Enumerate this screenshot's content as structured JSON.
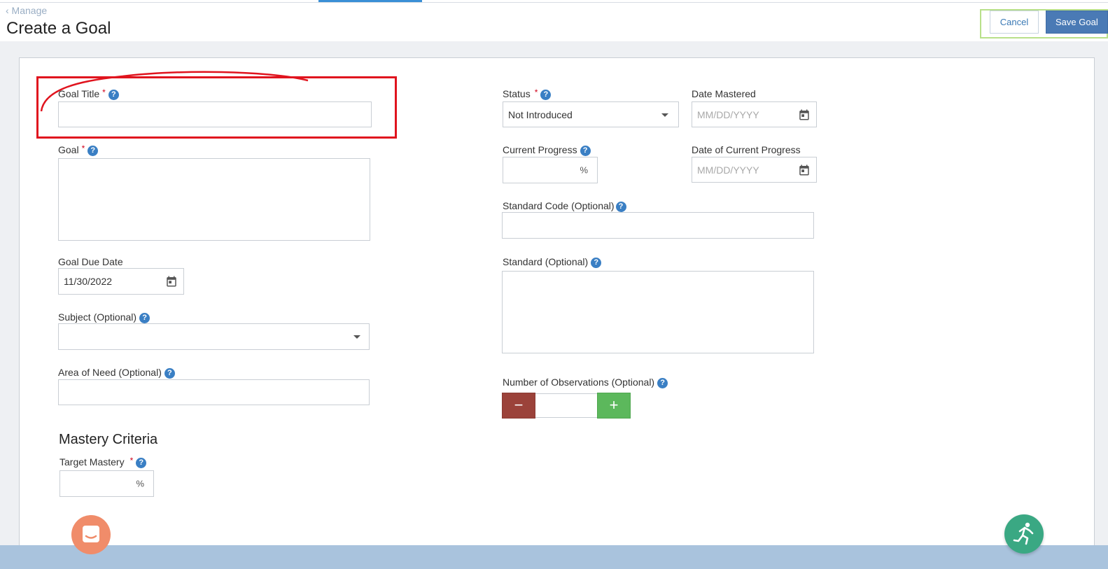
{
  "header": {
    "back_link": "‹ Manage",
    "title": "Create a Goal",
    "cancel_label": "Cancel",
    "save_label": "Save Goal"
  },
  "form": {
    "goal_title": {
      "label": "Goal Title",
      "required": "*",
      "value": ""
    },
    "goal": {
      "label": "Goal",
      "required": "*",
      "value": ""
    },
    "goal_due_date": {
      "label": "Goal Due Date",
      "value": "11/30/2022"
    },
    "subject": {
      "label": "Subject (Optional)",
      "selected": ""
    },
    "area_of_need": {
      "label": "Area of Need (Optional)",
      "value": ""
    },
    "status": {
      "label": "Status",
      "required": "*",
      "selected": "Not Introduced"
    },
    "date_mastered": {
      "label": "Date Mastered",
      "placeholder": "MM/DD/YYYY"
    },
    "current_progress": {
      "label": "Current Progress",
      "unit": "%"
    },
    "date_current_progress": {
      "label": "Date of Current Progress",
      "placeholder": "MM/DD/YYYY"
    },
    "standard_code": {
      "label": "Standard Code (Optional)",
      "value": ""
    },
    "standard": {
      "label": "Standard (Optional)",
      "value": ""
    },
    "observations": {
      "label": "Number of Observations (Optional)",
      "minus": "−",
      "plus": "+",
      "value": ""
    }
  },
  "mastery": {
    "section_title": "Mastery Criteria",
    "target_label": "Target Mastery",
    "required": "*",
    "unit": "%"
  },
  "help_glyph": "?",
  "colors": {
    "accent_blue": "#4a7ab5",
    "help_blue": "#3a7fc4",
    "annotation_red": "#e0141e",
    "minus_red": "#9b423a",
    "plus_green": "#5cb85c",
    "chat_orange": "#f08c6a",
    "run_green": "#3aa883"
  },
  "icons": [
    "calendar-icon",
    "chevron-down-icon",
    "help-icon",
    "chat-icon",
    "running-person-icon"
  ]
}
